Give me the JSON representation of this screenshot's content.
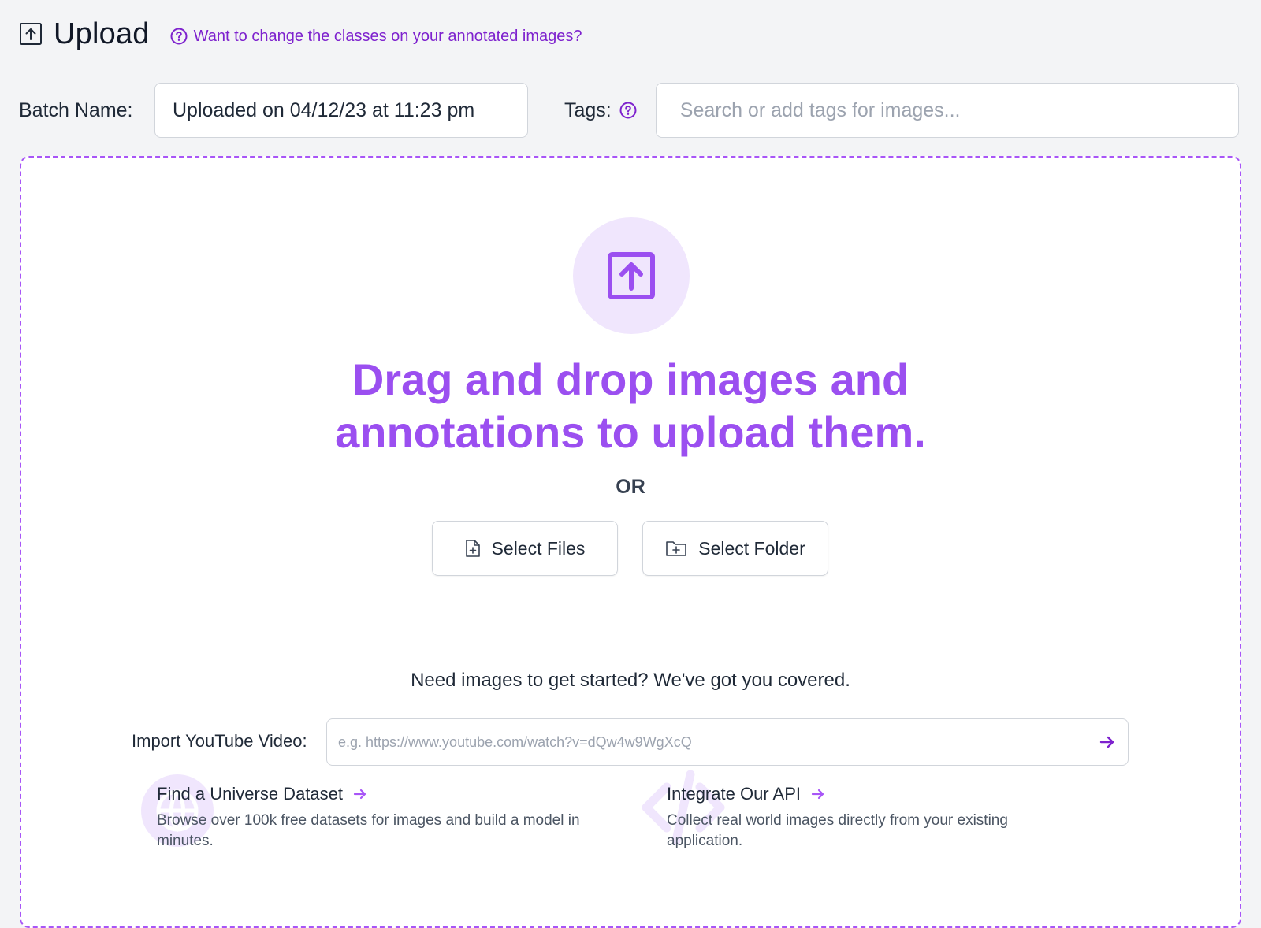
{
  "header": {
    "title": "Upload",
    "help_link": "Want to change the classes on your annotated images?"
  },
  "batch": {
    "label": "Batch Name:",
    "value": "Uploaded on 04/12/23 at 11:23 pm"
  },
  "tags": {
    "label": "Tags:",
    "placeholder": "Search or add tags for images..."
  },
  "dropzone": {
    "headline_line1": "Drag and drop images and",
    "headline_line2": "annotations to upload them.",
    "or": "OR",
    "select_files": "Select Files",
    "select_folder": "Select Folder"
  },
  "getting_started": {
    "heading": "Need images to get started? We've got you covered.",
    "youtube_label": "Import YouTube Video:",
    "youtube_placeholder": "e.g. https://www.youtube.com/watch?v=dQw4w9WgXcQ"
  },
  "cards": [
    {
      "title": "Find a Universe Dataset",
      "description": "Browse over 100k free datasets for images and build a model in minutes.",
      "icon": "globe-icon"
    },
    {
      "title": "Integrate Our API",
      "description": "Collect real world images directly from your existing application.",
      "icon": "code-icon"
    }
  ],
  "colors": {
    "accent": "#9b4ff0",
    "accent_dark": "#7e22ce",
    "accent_light": "#f0e6fd",
    "background": "#f3f4f6"
  }
}
